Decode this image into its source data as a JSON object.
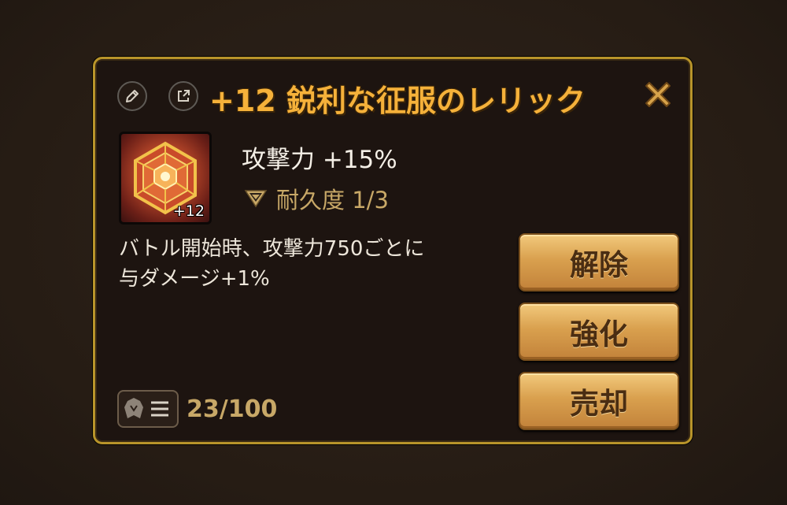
{
  "relic": {
    "title": "+12 鋭利な征服のレリック",
    "level_badge": "+12",
    "stat": "攻撃力 +15%",
    "durability": "耐久度 1/3",
    "description_line1": "バトル開始時、攻撃力750ごとに",
    "description_line2": "与ダメージ+1%"
  },
  "buttons": {
    "unequip": "解除",
    "enhance": "強化",
    "sell": "売却"
  },
  "inventory": {
    "capacity": "23/100"
  },
  "icons": {
    "edit": "pencil-icon",
    "share": "share-icon",
    "close": "close-icon",
    "durability": "diamond-shield-icon",
    "inventory": "relic-list-icon"
  },
  "colors": {
    "title": "#f5b13a",
    "border": "#b8942a",
    "button": "#d9a04e",
    "accent_text": "#c8a867"
  }
}
